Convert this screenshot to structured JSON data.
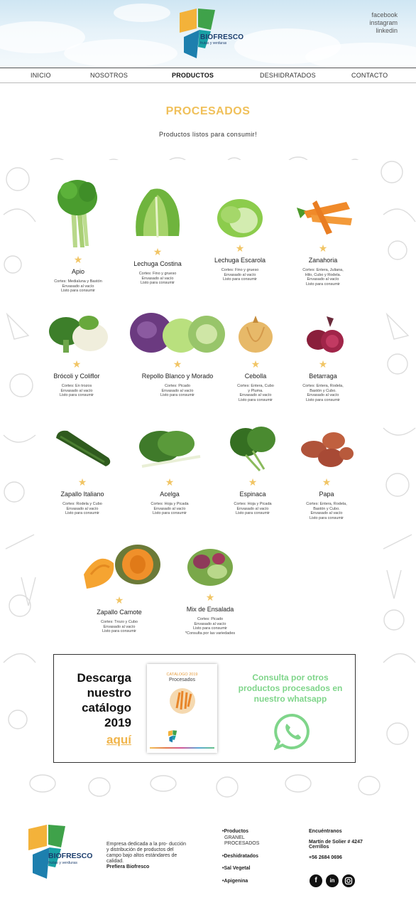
{
  "header": {
    "logo_name": "BIOFRESCO",
    "logo_tagline": "frutas y verduras",
    "social": [
      "facebook",
      "instagram",
      "linkedin"
    ]
  },
  "nav": {
    "items": [
      "INICIO",
      "NOSOTROS",
      "PRODUCTOS",
      "DESHIDRATADOS",
      "CONTACTO"
    ],
    "active": "PRODUCTOS"
  },
  "page": {
    "title": "PROCESADOS",
    "subtitle": "Productos listos para consumir!"
  },
  "products": [
    {
      "name": "Apio",
      "desc": [
        "Cortes: Medialuna y Bastón",
        "Envasado al vacío",
        "Listo para consumir"
      ],
      "icon": "celery"
    },
    {
      "name": "Lechuga Costina",
      "desc": [
        "Cortes: Fino y grueso",
        "Envasado al vacío",
        "Listo para consumir"
      ],
      "icon": "romaine-lettuce"
    },
    {
      "name": "Lechuga Escarola",
      "desc": [
        "Cortes: Fino y grueso",
        "Envasado al vacío",
        "Listo para consumir"
      ],
      "icon": "escarole-lettuce"
    },
    {
      "name": "Zanahoria",
      "desc": [
        "Cortes: Entera, Juliana,",
        "Hilo, Cubo y Rodela.",
        "Envasado al vacío",
        "Listo para consumir"
      ],
      "icon": "carrots"
    },
    {
      "name": "Brócoli y Coliflor",
      "desc": [
        "Cortes: En trozos",
        "Envasado al vacío",
        "Listo para consumir"
      ],
      "icon": "broccoli-cauliflower"
    },
    {
      "name": "Repollo Blanco y Morado",
      "desc": [
        "Cortes: Picado",
        "Envasado al vacío",
        "Listo para consumir"
      ],
      "icon": "cabbages"
    },
    {
      "name": "Cebolla",
      "desc": [
        "Cortes: Entera, Cubo",
        "y Pluma.",
        "Envasado al vacío",
        "Listo para consumir"
      ],
      "icon": "onion"
    },
    {
      "name": "Betarraga",
      "desc": [
        "Cortes: Entera, Rodela,",
        "Bastón y Cubo.",
        "Envasado al vacío",
        "Listo para consumir"
      ],
      "icon": "beet"
    },
    {
      "name": "Zapallo Italiano",
      "desc": [
        "Cortes: Rodela y Cubo",
        "Envasado al vacío",
        "Listo para consumir"
      ],
      "icon": "zucchini"
    },
    {
      "name": "Acelga",
      "desc": [
        "Cortes: Hoja y Picada",
        "Envasado al vacío",
        "Listo para consumir"
      ],
      "icon": "chard"
    },
    {
      "name": "Espinaca",
      "desc": [
        "Cortes: Hoja y Picada",
        "Envasado al vacío",
        "Listo para consumir"
      ],
      "icon": "spinach"
    },
    {
      "name": "Papa",
      "desc": [
        "Cortes: Entera, Rodela,",
        "Bastón y Cubo.",
        "Envasado al vacío",
        "Listo para consumir"
      ],
      "icon": "potatoes"
    },
    {
      "name": "Zapallo Camote",
      "desc": [
        "Cortes: Trozo y Cubo",
        "Envasado al vacío",
        "Listo para consumir"
      ],
      "icon": "pumpkin"
    },
    {
      "name": "Mix de Ensalada",
      "desc": [
        "Cortes: Picado",
        "Envasado al vacío",
        "Listo para consumir",
        "*Consulta por las variedades"
      ],
      "icon": "salad-mix"
    }
  ],
  "promo": {
    "heading": "Descarga\nnuestro\ncatálogo\n2019",
    "link": "aquí",
    "catalog_line1": "CATÁLOGO 2019",
    "catalog_line2": "Procesados",
    "whatsapp_text": "Consulta por otros productos procesados en nuestro whatsapp"
  },
  "footer": {
    "logo_name": "BIOFRESCO",
    "logo_tagline": "frutas y verduras",
    "description": "Empresa dedicada a la pro- ducción y distribución de productos del campo bajo altos estándares de calidad.",
    "motto": "Prefiera Biofresco",
    "products_label": "•Productos",
    "products_sub": [
      "GRANEL",
      "PROCESADOS"
    ],
    "links": [
      "•Deshidratados",
      "•Sal Vegetal",
      "•Apigenina"
    ],
    "contact_title": "Encuéntranos",
    "address_line1": "Martín de Solier # 4247",
    "address_line2": "Cerrillos",
    "phone": "+56 2684 0696"
  },
  "colors": {
    "title_yellow": "#f0c05a",
    "star": "#f1c565",
    "link_orange": "#f0b44a",
    "whatsapp_green": "#7fd58a",
    "brand_navy": "#1b3d6d"
  }
}
